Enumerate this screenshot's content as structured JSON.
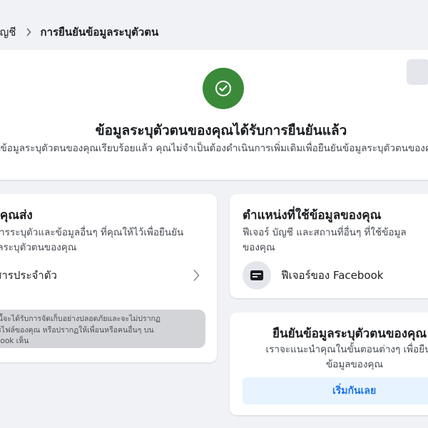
{
  "breadcrumb": {
    "prev_label": "บัญชี",
    "current_label": "การยืนยันข้อมูลระบุตัวตน"
  },
  "status": {
    "title": "ข้อมูลระบุตัวตนของคุณได้รับการยืนยันแล้ว",
    "description": "ยืนยันข้อมูลระบุตัวตนของคุณเรียบร้อยแล้ว คุณไม่จำเป็นต้องดำเนินการเพิ่มเติมเพื่อยืนยันข้อมูลระบุตัวตนของคุณอีก"
  },
  "sent_card": {
    "title": "สิ่งที่คุณส่ง",
    "description": "เอกสารระบุตัวและข้อมูลอื่นๆ ที่คุณให้ไว้เพื่อยืนยันข้อมูลระบุตัวตนของคุณ",
    "document_label": "เอกสารประจำตัว",
    "note_lines": [
      "ข้อมูลนี้จะได้รับการจัดเก็บอย่างปลอดภัยและจะไม่ปรากฏ",
      "บนโปรไฟล์ของคุณ หรือปรากฏให้เพื่อนหรือคนอื่นๆ บน",
      "Facebook เห็น"
    ]
  },
  "usage_card": {
    "title": "ตำแหน่งที่ใช้ข้อมูลของคุณ",
    "description_lines": [
      "ฟีเจอร์ บัญชี และสถานที่อื่นๆ ที่ใช้ข้อมูล",
      "ของคุณ"
    ],
    "feature_label": "ฟีเจอร์ของ Facebook",
    "feature_icon": "card-icon"
  },
  "verify_card": {
    "title": "ยืนยันข้อมูลระบุตัวตนของคุณ",
    "description_lines": [
      "เราจะแนะนำคุณในขั้นตอนต่างๆ เพื่อยืนยัน",
      "ข้อมูลของคุณ"
    ],
    "start_button": "เริ่มกันเลย"
  },
  "colors": {
    "success_green": "#3a8a3a",
    "link_blue": "#1b74e4",
    "button_bg": "#e7f3ff",
    "page_bg": "#f0f2f5"
  }
}
